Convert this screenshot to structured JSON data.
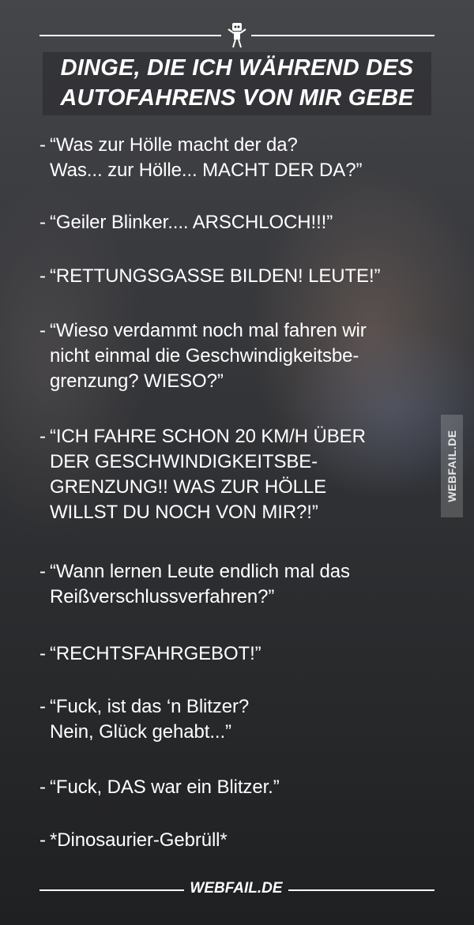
{
  "header": {
    "title_line_1": "DINGE, DIE ICH WÄHREND DES",
    "title_line_2": "AUTOFAHRENS VON MIR GEBE"
  },
  "quotes": [
    {
      "bullet": "-",
      "text": "“Was zur Hölle macht der da?\nWas... zur Hölle... MACHT DER DA?”"
    },
    {
      "bullet": "-",
      "text": "“Geiler Blinker.... ARSCHLOCH!!!”"
    },
    {
      "bullet": "-",
      "text": "“RETTUNGSGASSE BILDEN! LEUTE!”"
    },
    {
      "bullet": "-",
      "text": "“Wieso verdammt noch mal fahren wir\nnicht einmal die Geschwindigkeitsbe-\ngrenzung? WIESO?”"
    },
    {
      "bullet": "-",
      "text": "“ICH FAHRE SCHON 20 KM/H ÜBER\nDER GESCHWINDIGKEITSBE-\nGRENZUNG!! WAS ZUR HÖLLE\nWILLST DU NOCH VON MIR?!”"
    },
    {
      "bullet": "-",
      "text": "“Wann lernen Leute endlich mal das\nReißverschlussverfahren?”"
    },
    {
      "bullet": "-",
      "text": "“RECHTSFAHRGEBOT!”"
    },
    {
      "bullet": "-",
      "text": "“Fuck, ist das ‘n Blitzer?\nNein, Glück gehabt...”"
    },
    {
      "bullet": "-",
      "text": "“Fuck, DAS war ein Blitzer.”"
    },
    {
      "bullet": "-",
      "text": "*Dinosaurier-Gebrüll*"
    }
  ],
  "watermark": {
    "text": "WEBFAIL.DE"
  },
  "footer": {
    "brand": "WEBFAIL.DE"
  },
  "icons": {
    "mascot": "webfail-mascot-icon"
  },
  "colors": {
    "text": "#ffffff",
    "background": "#2f3033"
  }
}
